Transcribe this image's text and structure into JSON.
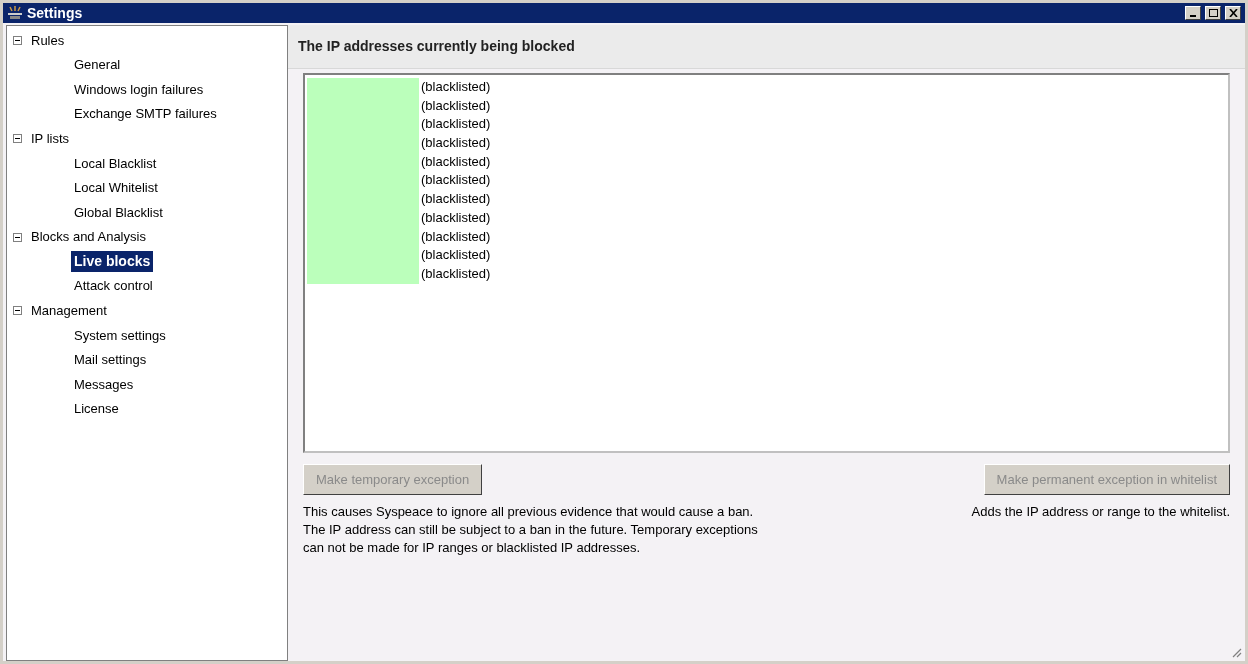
{
  "window": {
    "title": "Settings"
  },
  "tree": [
    {
      "label": "Rules",
      "expanded": true,
      "children": [
        {
          "label": "General",
          "selected": false
        },
        {
          "label": "Windows login failures",
          "selected": false
        },
        {
          "label": "Exchange SMTP failures",
          "selected": false
        }
      ]
    },
    {
      "label": "IP lists",
      "expanded": true,
      "children": [
        {
          "label": "Local Blacklist",
          "selected": false
        },
        {
          "label": "Local Whitelist",
          "selected": false
        },
        {
          "label": "Global Blacklist",
          "selected": false
        }
      ]
    },
    {
      "label": "Blocks and Analysis",
      "expanded": true,
      "children": [
        {
          "label": "Live blocks",
          "selected": true
        },
        {
          "label": "Attack control",
          "selected": false
        }
      ]
    },
    {
      "label": "Management",
      "expanded": true,
      "children": [
        {
          "label": "System settings",
          "selected": false
        },
        {
          "label": "Mail settings",
          "selected": false
        },
        {
          "label": "Messages",
          "selected": false
        },
        {
          "label": "License",
          "selected": false
        }
      ]
    }
  ],
  "panel": {
    "heading": "The IP addresses currently being blocked",
    "blocked": [
      {
        "status": "(blacklisted)"
      },
      {
        "status": "(blacklisted)"
      },
      {
        "status": "(blacklisted)"
      },
      {
        "status": "(blacklisted)"
      },
      {
        "status": "(blacklisted)"
      },
      {
        "status": "(blacklisted)"
      },
      {
        "status": "(blacklisted)"
      },
      {
        "status": "(blacklisted)"
      },
      {
        "status": "(blacklisted)"
      },
      {
        "status": "(blacklisted)"
      },
      {
        "status": "(blacklisted)"
      }
    ],
    "temporary": {
      "label": "Make temporary exception",
      "disabled": true,
      "description": "This causes Syspeace to ignore all previous evidence that would cause a ban. The IP address can still be subject to a ban in the future. Temporary exceptions can not be made for IP ranges or blacklisted IP addresses."
    },
    "permanent": {
      "label": "Make permanent exception in whitelist",
      "disabled": true,
      "description": "Adds the IP address or range to the whitelist."
    }
  }
}
